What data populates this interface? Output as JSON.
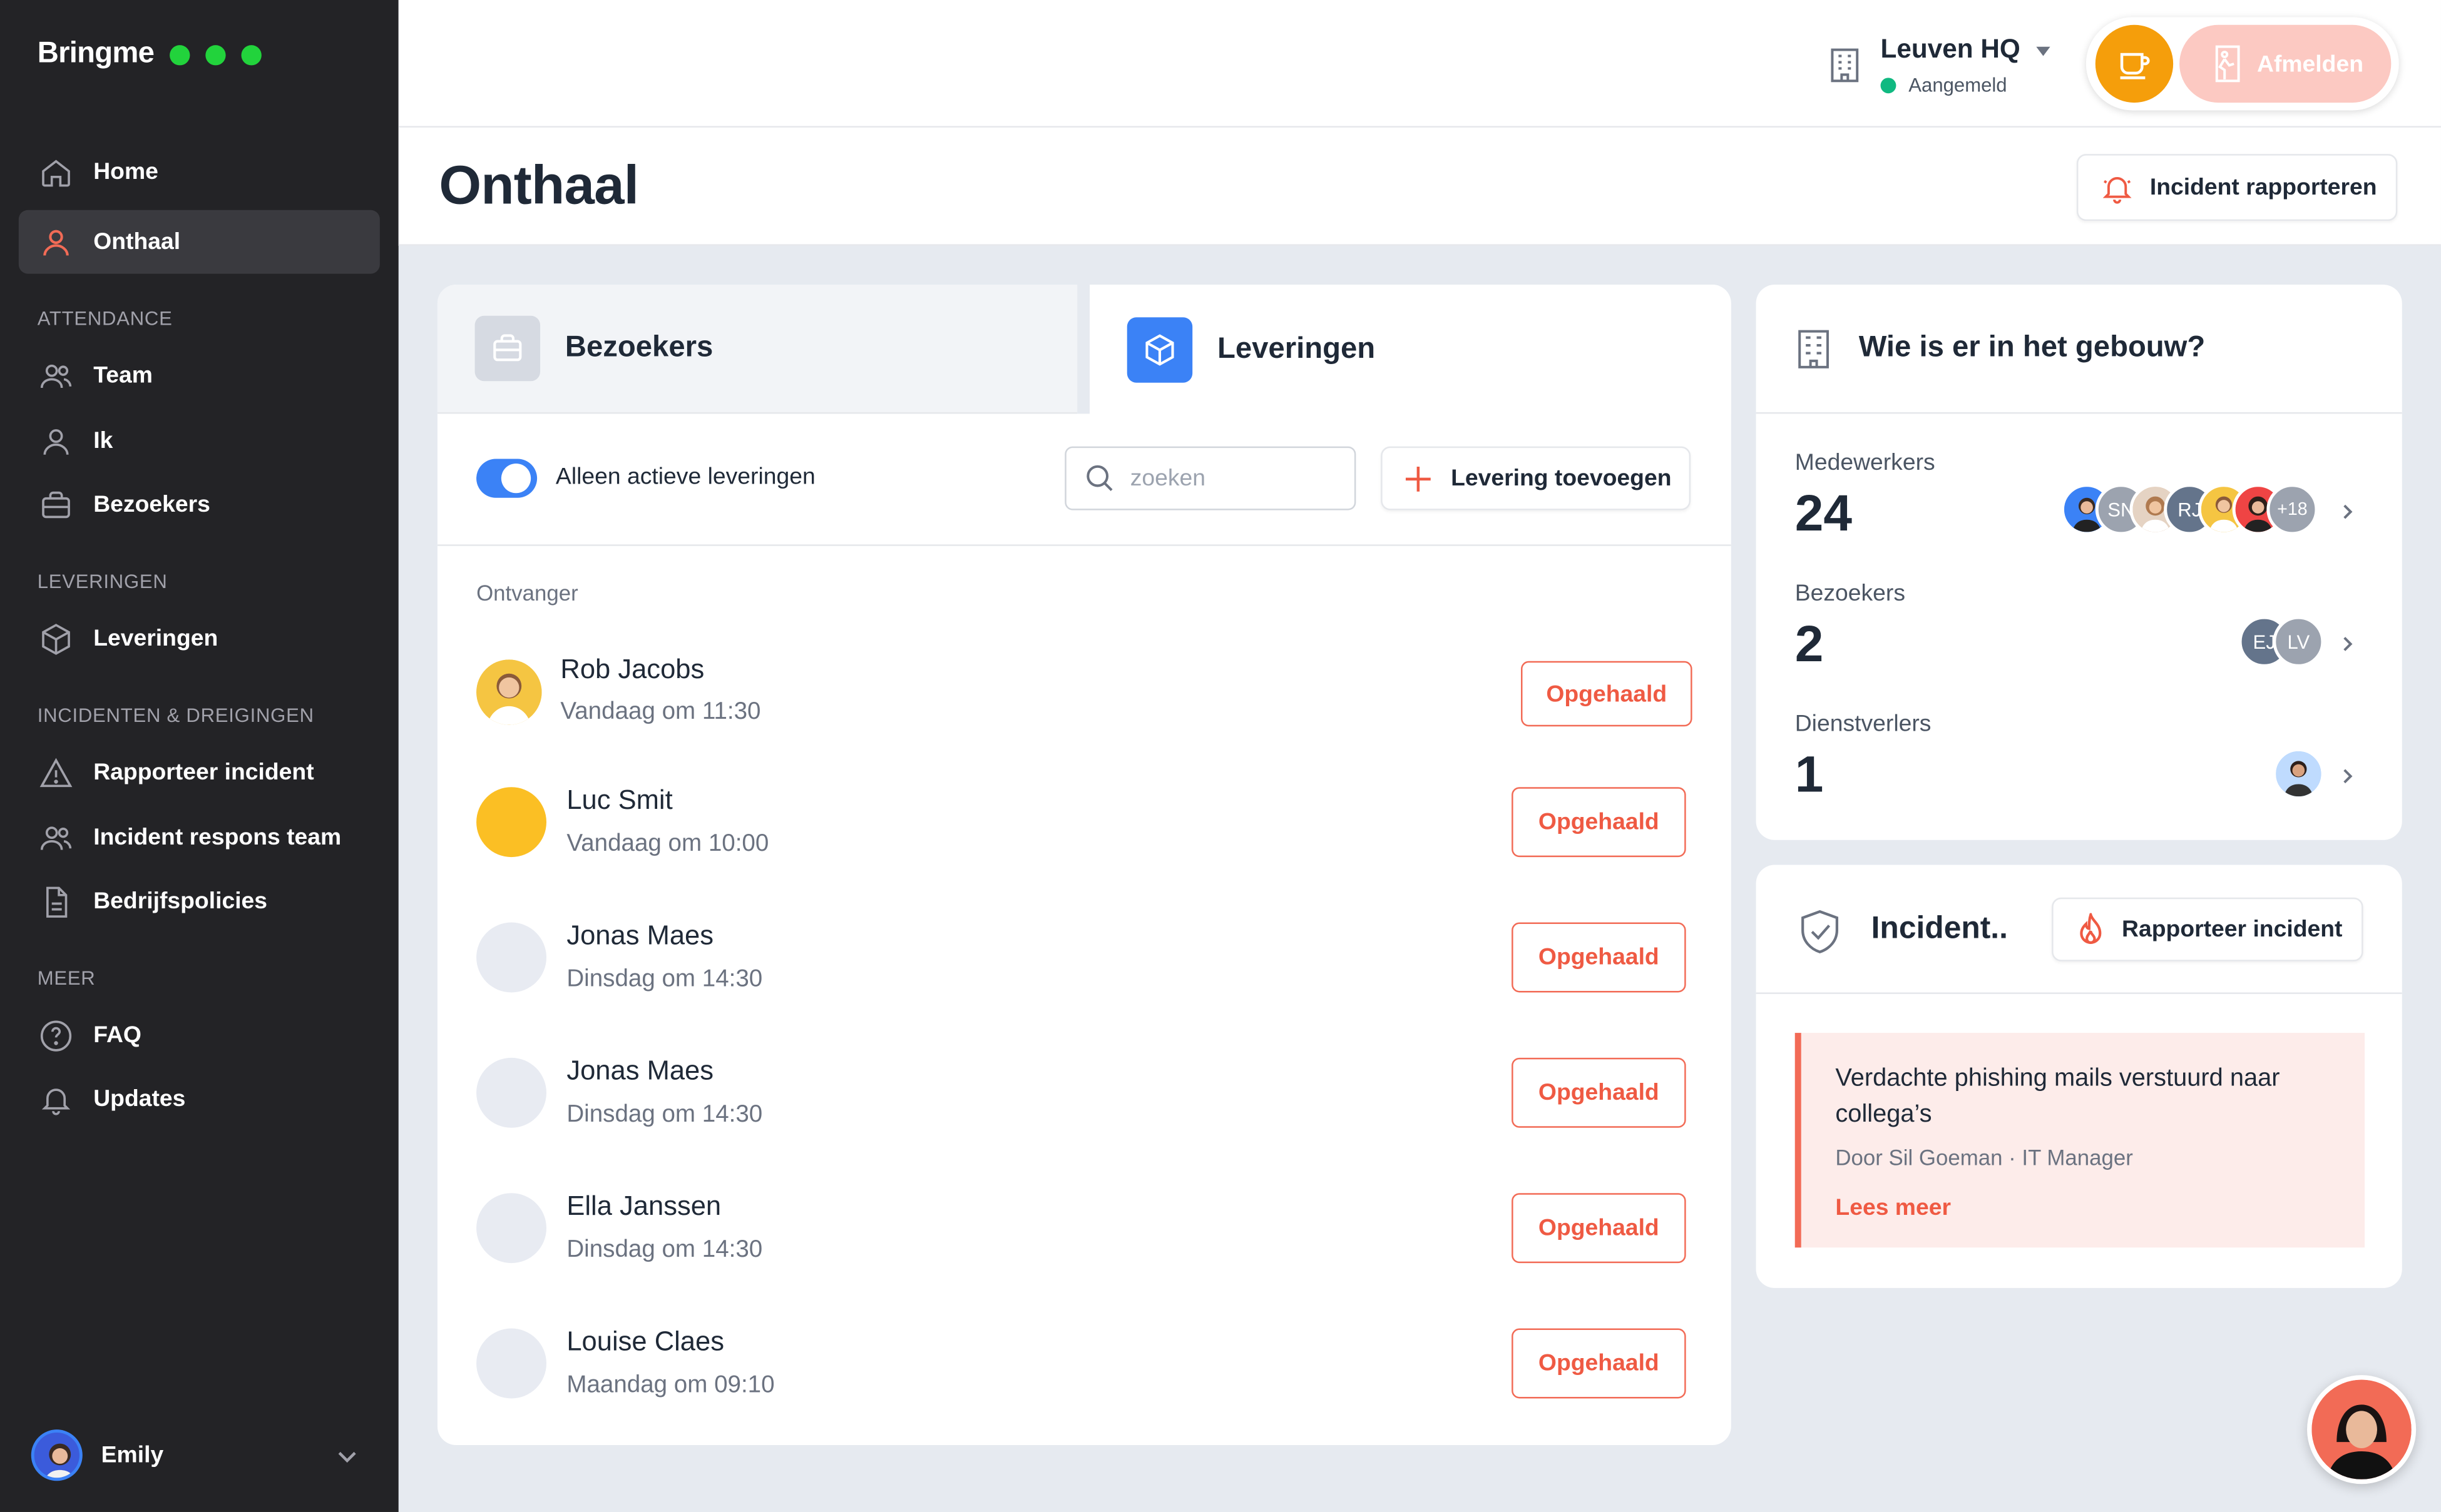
{
  "brand": {
    "name": "Bringme",
    "accent": "#22d33c"
  },
  "sidebar": {
    "top_items": [
      {
        "label": "Home",
        "icon": "home-icon"
      },
      {
        "label": "Onthaal",
        "icon": "person-icon",
        "active": true
      }
    ],
    "sections": [
      {
        "title": "ATTENDANCE",
        "items": [
          {
            "label": "Team",
            "icon": "users-icon"
          },
          {
            "label": "Ik",
            "icon": "user-icon"
          },
          {
            "label": "Bezoekers",
            "icon": "briefcase-icon"
          }
        ]
      },
      {
        "title": "LEVERINGEN",
        "items": [
          {
            "label": "Leveringen",
            "icon": "box-icon"
          }
        ]
      },
      {
        "title": "INCIDENTEN & DREIGINGEN",
        "items": [
          {
            "label": "Rapporteer incident",
            "icon": "warning-icon"
          },
          {
            "label": "Incident respons team",
            "icon": "users-icon"
          },
          {
            "label": "Bedrijfspolicies",
            "icon": "document-icon"
          }
        ]
      },
      {
        "title": "MEER",
        "items": [
          {
            "label": "FAQ",
            "icon": "question-icon"
          },
          {
            "label": "Updates",
            "icon": "bell-icon"
          }
        ]
      }
    ],
    "user": {
      "name": "Emily"
    }
  },
  "topbar": {
    "location": "Leuven HQ",
    "status": "Aangemeld",
    "logout_label": "Afmelden",
    "coffee_color": "#f59e0b",
    "logout_color": "#fcc9c2"
  },
  "page": {
    "title": "Onthaal",
    "report_button": "Incident rapporteren"
  },
  "tabs": [
    {
      "label": "Bezoekers",
      "active": false
    },
    {
      "label": "Leveringen",
      "active": true
    }
  ],
  "deliveries": {
    "toggle_label": "Alleen actieve leveringen",
    "toggle_on": true,
    "search_placeholder": "zoeken",
    "add_button": "Levering toevoegen",
    "column_header": "Ontvanger",
    "rows": [
      {
        "name": "Rob Jacobs",
        "time": "Vandaag om 11:30",
        "action": "Opgehaald"
      },
      {
        "name": "Luc Smit",
        "time": "Vandaag om 10:00",
        "action": "Opgehaald"
      },
      {
        "name": "Jonas Maes",
        "time": "Dinsdag om 14:30",
        "action": "Opgehaald"
      },
      {
        "name": "Jonas Maes",
        "time": "Dinsdag om 14:30",
        "action": "Opgehaald"
      },
      {
        "name": "Ella Janssen",
        "time": "Dinsdag om 14:30",
        "action": "Opgehaald"
      },
      {
        "name": "Louise Claes",
        "time": "Maandag om 09:10",
        "action": "Opgehaald"
      }
    ]
  },
  "building": {
    "title": "Wie is er in het gebouw?",
    "stats": [
      {
        "label": "Medewerkers",
        "value": "24",
        "avatars": [
          "",
          "SN",
          "",
          "RJ",
          "",
          "",
          "+18"
        ]
      },
      {
        "label": "Bezoekers",
        "value": "2",
        "avatars": [
          "EJ",
          "LV"
        ]
      },
      {
        "label": "Dienstverlers",
        "value": "1",
        "avatars": [
          ""
        ]
      }
    ]
  },
  "incidents": {
    "title": "Incident..",
    "report_button": "Rapporteer incident",
    "alert": {
      "title": "Verdachte phishing mails verstuurd naar collega’s",
      "meta": "Door Sil Goeman · IT Manager",
      "link": "Lees meer"
    }
  }
}
